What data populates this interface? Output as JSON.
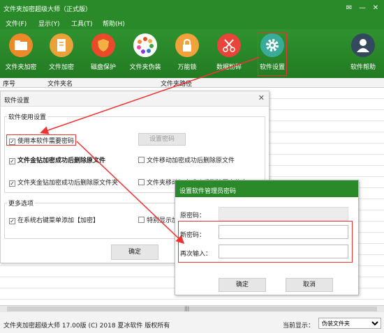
{
  "app": {
    "title": "文件夹加密超级大师（正式版）",
    "window_controls": [
      "✉",
      "—",
      "✕"
    ],
    "menu": [
      "文件(F)",
      "显示(Y)",
      "工具(T)",
      "帮助(H)"
    ],
    "toolbar": [
      {
        "label": "文件夹加密",
        "icon": "folder-icon"
      },
      {
        "label": "文件加密",
        "icon": "file-icon"
      },
      {
        "label": "磁盘保护",
        "icon": "shield-icon"
      },
      {
        "label": "文件夹伪装",
        "icon": "palette-icon"
      },
      {
        "label": "万能锁",
        "icon": "lock-icon"
      },
      {
        "label": "数据粉碎",
        "icon": "scissors-icon"
      },
      {
        "label": "软件设置",
        "icon": "gear-icon"
      },
      {
        "label": "软件帮助",
        "icon": "user-help-icon"
      }
    ],
    "table_columns": [
      "序号",
      "文件夹名",
      "文件夹路径",
      "夹"
    ],
    "status": {
      "copyright": "文件夹加密超级大师 17.00版 (C) 2018  夏冰软件 版权所有",
      "current_display_label": "当前显示：",
      "current_display_value": "伪装文件夹"
    },
    "scroll_grip": "|||"
  },
  "settings_dialog": {
    "title": "软件设置",
    "close": "✕",
    "group1_title": "软件使用设置",
    "require_password": "使用本软件需要密码",
    "set_password_button": "设置密码",
    "option1": "文件金钻加密成功后删除原文件",
    "option2": "文件移动加密成功后删除原文件",
    "option3": "文件夹金钻加密成功后删除原文件夹",
    "option4": "文件夹移动加密成功后删除原文件夹",
    "group2_title": "更多选项",
    "option5": "在系统右键菜单添加【加密】",
    "option6": "特别显示加",
    "ok": "确定"
  },
  "password_dialog": {
    "title": "设置软件管理员密码",
    "old_password_label": "原密码：",
    "new_password_label": "新密码：",
    "confirm_label": "再次输入：",
    "ok": "确定",
    "cancel": "取消"
  },
  "colors": {
    "brand_green": "#2a8a2a",
    "highlight_red": "#e33333"
  }
}
